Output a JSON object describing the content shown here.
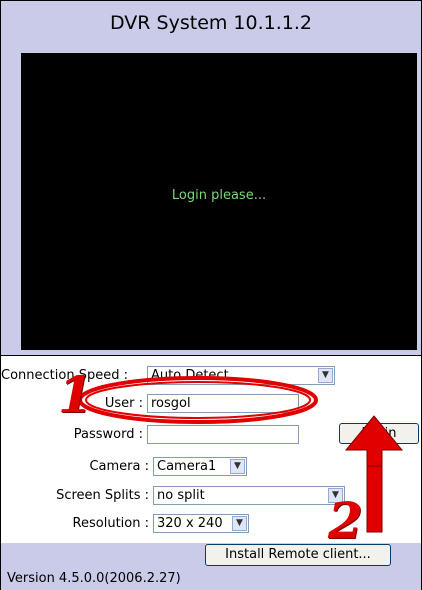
{
  "window": {
    "title": "DVR System 10.1.1.2"
  },
  "video": {
    "message": "Login please..."
  },
  "connection": {
    "speed_label": "Connection Speed :",
    "speed_value": "Auto Detect",
    "user_label": "User :",
    "user_value": "rosgol",
    "password_label": "Password :",
    "password_value": "",
    "login_button": "Login"
  },
  "camera_settings": {
    "camera_label": "Camera :",
    "camera_value": "Camera1",
    "splits_label": "Screen Splits :",
    "splits_value": "no split",
    "resolution_label": "Resolution :",
    "resolution_value": "320 x 240"
  },
  "footer": {
    "install_button": "Install Remote client...",
    "version": "Version 4.5.0.0(2006.2.27)"
  },
  "annotations": {
    "step1": "1",
    "step2": "2",
    "color": "#e00000"
  },
  "icons": {
    "dropdown": "chevron-down-icon"
  },
  "theme": {
    "panel_bg": "#c9cbe8",
    "video_bg": "#000000",
    "message_color": "#7dd87d"
  }
}
